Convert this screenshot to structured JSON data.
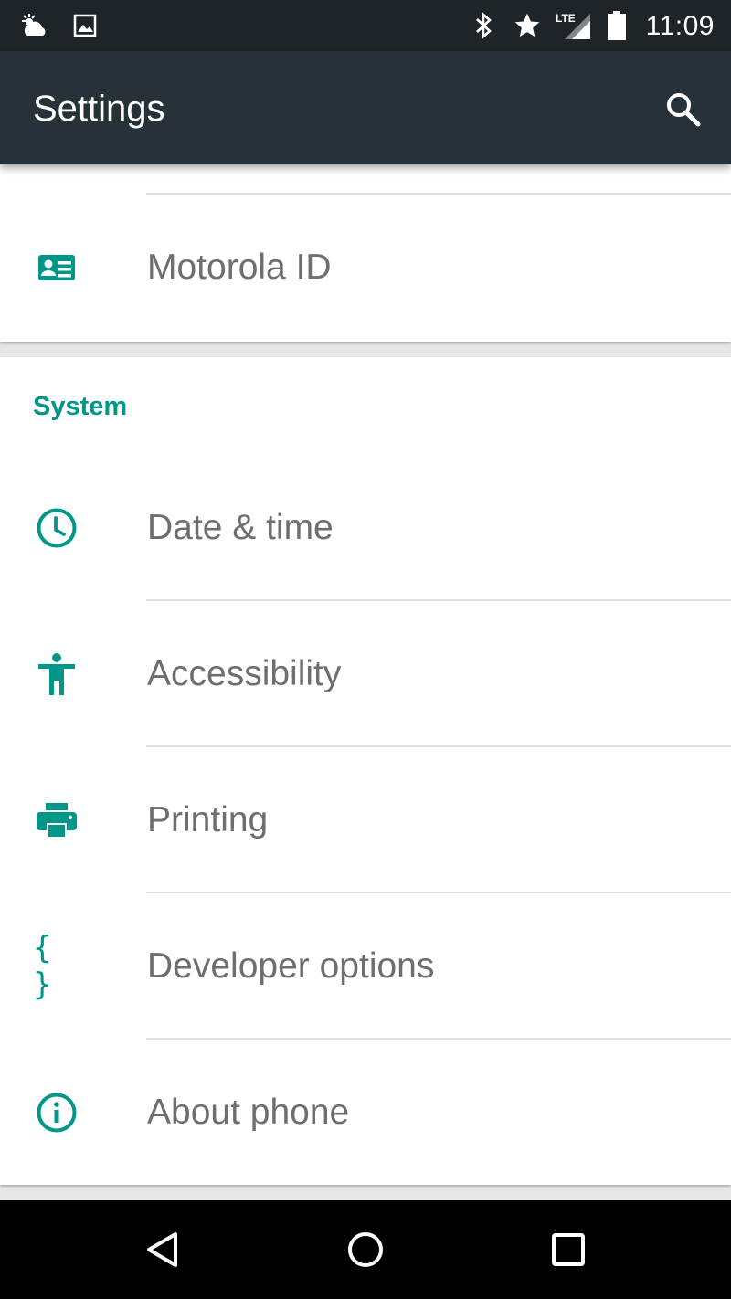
{
  "status_bar": {
    "time": "11:09",
    "network_label": "LTE",
    "left_icons": [
      "weather-partly-cloudy-icon",
      "image-notification-icon"
    ],
    "right_icons": [
      "bluetooth-icon",
      "star-icon",
      "lte-signal-icon",
      "battery-icon"
    ]
  },
  "app_bar": {
    "title": "Settings",
    "search_icon": "search-icon",
    "background": "#263238"
  },
  "accent_color": "#009688",
  "personal_items": [
    {
      "label": "Motorola ID",
      "icon": "id-card-icon"
    }
  ],
  "system_section": {
    "header": "System",
    "items": [
      {
        "label": "Date & time",
        "icon": "clock-icon"
      },
      {
        "label": "Accessibility",
        "icon": "accessibility-icon"
      },
      {
        "label": "Printing",
        "icon": "printer-icon"
      },
      {
        "label": "Developer options",
        "icon": "braces-icon",
        "glyph": "{ }"
      },
      {
        "label": "About phone",
        "icon": "info-icon"
      }
    ]
  },
  "nav_bar": {
    "buttons": [
      "back-icon",
      "home-icon",
      "recents-icon"
    ]
  }
}
